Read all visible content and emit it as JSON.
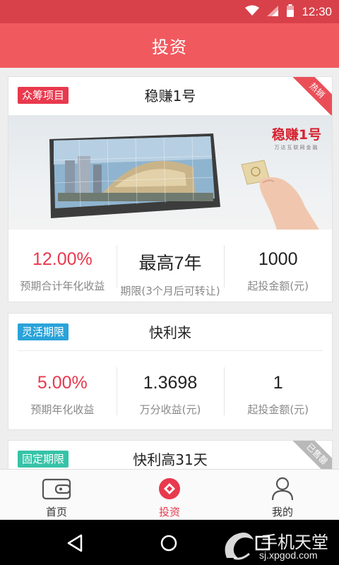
{
  "status_bar": {
    "time": "12:30",
    "icons": [
      "wifi-icon",
      "signal-icon",
      "battery-icon"
    ]
  },
  "header": {
    "title": "投资"
  },
  "products": [
    {
      "tag": "众筹项目",
      "name": "稳赚1号",
      "ribbon": "热销",
      "banner": {
        "brand": "稳赚1号",
        "slogan": "万达互联网金融"
      },
      "stats": [
        {
          "value": "12.00%",
          "label": "预期合计年化收益"
        },
        {
          "value": "最高7年",
          "label": "期限(3个月后可转让)"
        },
        {
          "value": "1000",
          "label": "起投金额(元)"
        }
      ]
    },
    {
      "tag": "灵活期限",
      "name": "快利来",
      "stats": [
        {
          "value": "5.00%",
          "label": "预期年化收益"
        },
        {
          "value": "1.3698",
          "label": "万分收益(元)"
        },
        {
          "value": "1",
          "label": "起投金额(元)"
        }
      ]
    },
    {
      "tag": "固定期限",
      "name": "快利高31天",
      "ribbon": "已售罄"
    }
  ],
  "tabbar": {
    "active": 1,
    "items": [
      {
        "label": "首页",
        "icon": "wallet-icon"
      },
      {
        "label": "投资",
        "icon": "invest-icon"
      },
      {
        "label": "我的",
        "icon": "user-icon"
      }
    ]
  },
  "navbar": {
    "buttons": [
      "back-icon",
      "home-icon",
      "recents-icon"
    ]
  },
  "watermark": {
    "title": "手机天堂",
    "url": "sj.xpgod.com"
  },
  "colors": {
    "accent": "#f05a5f",
    "status_bar": "#d8414a",
    "tag_red": "#e8394d",
    "tag_blue": "#2aa3d9",
    "tag_teal": "#36c3a7"
  }
}
